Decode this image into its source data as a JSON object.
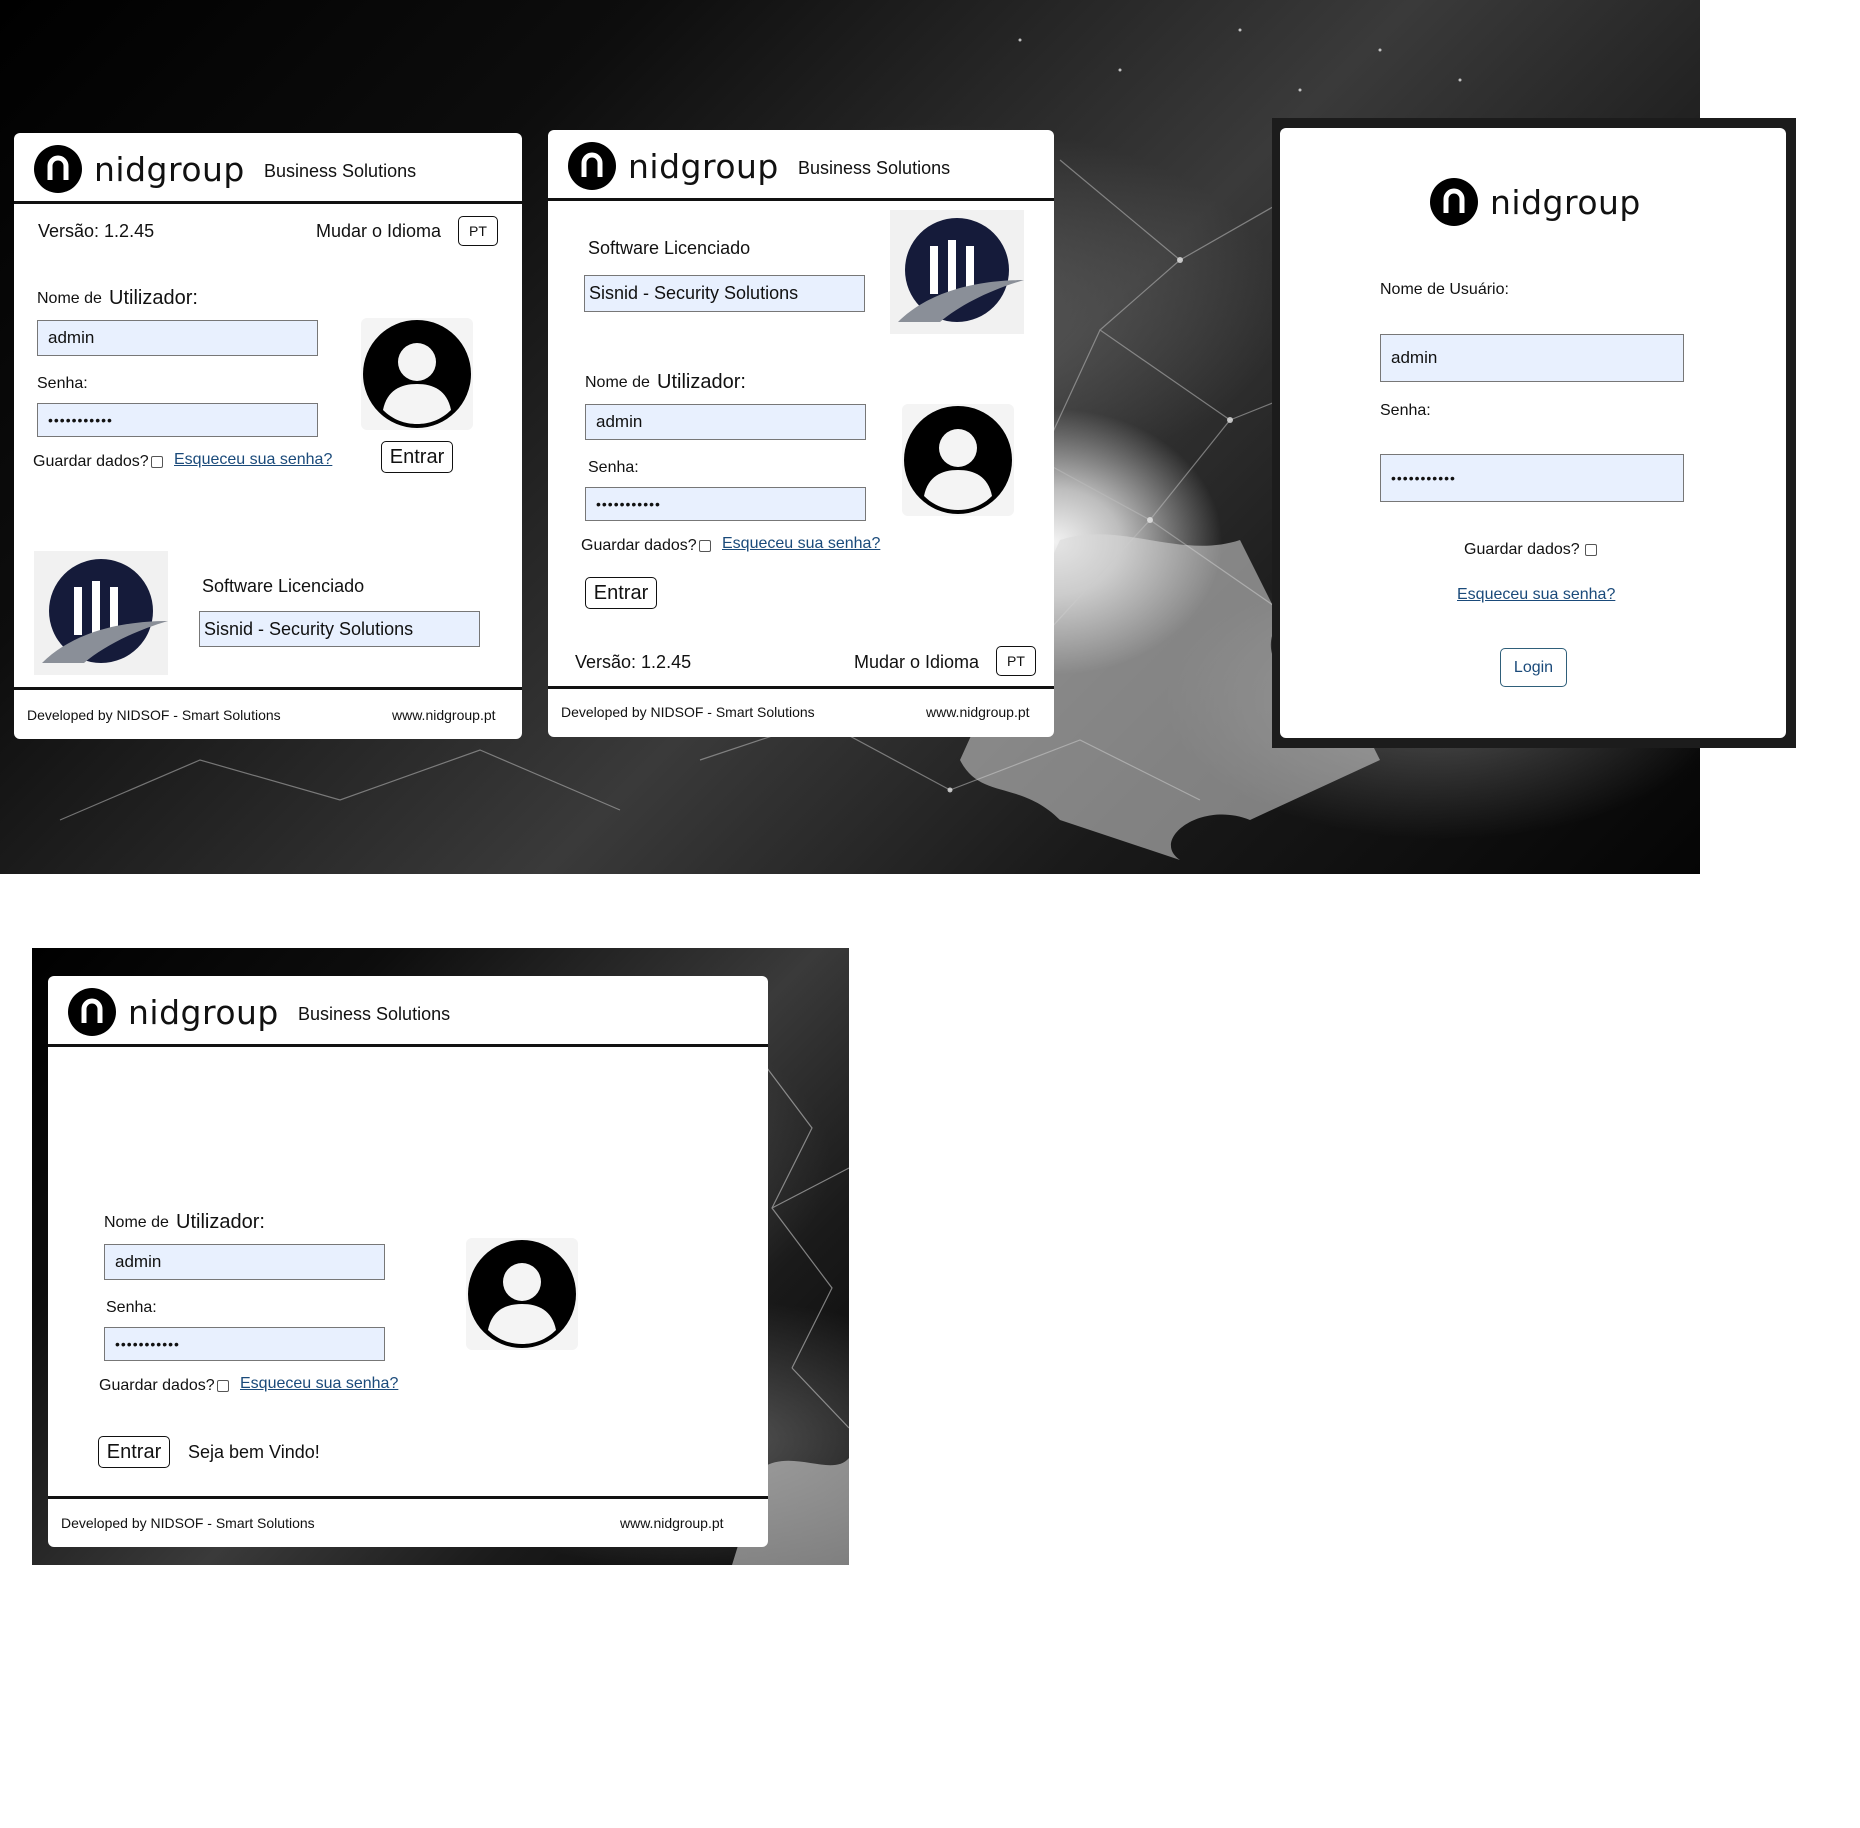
{
  "brand": {
    "name": "nidgroup",
    "logo_letter": "n",
    "tagline": "Business Solutions"
  },
  "common": {
    "version": "Versão: 1.2.45",
    "change_language": "Mudar o Idioma",
    "language_code": "PT",
    "username_prefix": "Nome de",
    "username_word": "Utilizador:",
    "username_value": "admin",
    "password_label": "Senha:",
    "password_value": "•••••••••••",
    "remember_label": "Guardar dados?",
    "forgot_link": "Esqueceu sua senha?",
    "login_button": "Entrar",
    "licensed_label": "Software Licenciado",
    "licensed_value": "Sisnid - Security Solutions",
    "footer_left": "Developed by NIDSOF - Smart Solutions",
    "footer_right": "www.nidgroup.pt"
  },
  "variant3": {
    "username_label": "Nome de Usuário:",
    "username_value": "admin",
    "password_label": "Senha:",
    "password_value": "•••••••••••",
    "remember_label": "Guardar dados?",
    "forgot_link": "Esqueceu sua senha?",
    "login_button": "Login"
  },
  "variant4": {
    "welcome": "Seja bem Vindo!"
  },
  "colors": {
    "input_bg": "#e8f0fe",
    "link": "#1a4a7a",
    "brand_navy": "#151b3a",
    "brand_grey": "#8a8f98"
  }
}
